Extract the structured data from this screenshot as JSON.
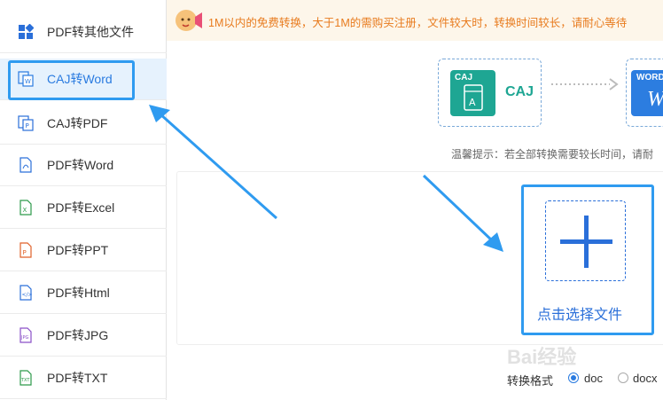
{
  "sidebar": {
    "items": [
      {
        "label": "PDF转其他文件",
        "icon": "apps-grid-icon",
        "active": false
      },
      {
        "label": "CAJ转Word",
        "icon": "caj-word-icon",
        "active": true
      },
      {
        "label": "CAJ转PDF",
        "icon": "caj-pdf-icon",
        "active": false
      },
      {
        "label": "PDF转Word",
        "icon": "pdf-file-icon",
        "active": false
      },
      {
        "label": "PDF转Excel",
        "icon": "excel-file-icon",
        "active": false
      },
      {
        "label": "PDF转PPT",
        "icon": "ppt-file-icon",
        "active": false
      },
      {
        "label": "PDF转Html",
        "icon": "html-file-icon",
        "active": false
      },
      {
        "label": "PDF转JPG",
        "icon": "jpg-file-icon",
        "active": false
      },
      {
        "label": "PDF转TXT",
        "icon": "txt-file-icon",
        "active": false
      }
    ]
  },
  "notice": {
    "text": "1M以内的免费转换，大于1M的需购买注册，文件较大时，转换时间较长，请耐心等待"
  },
  "conversion": {
    "source_tile": "CAJ",
    "source_label": "CAJ",
    "target_tile": "WORD",
    "target_glyph": "W"
  },
  "tip": "温馨提示：若全部转换需要较长时间，请耐",
  "upload": {
    "label": "点击选择文件"
  },
  "format": {
    "label": "转换格式",
    "options": [
      {
        "label": "doc",
        "checked": true
      },
      {
        "label": "docx",
        "checked": false
      }
    ]
  },
  "watermark": "Bai经验",
  "colors": {
    "accent": "#2f9bf0",
    "active_text": "#2a7be0",
    "caj_green": "#1ea693",
    "word_blue": "#2c7de0",
    "notice_orange": "#e87b1e"
  }
}
